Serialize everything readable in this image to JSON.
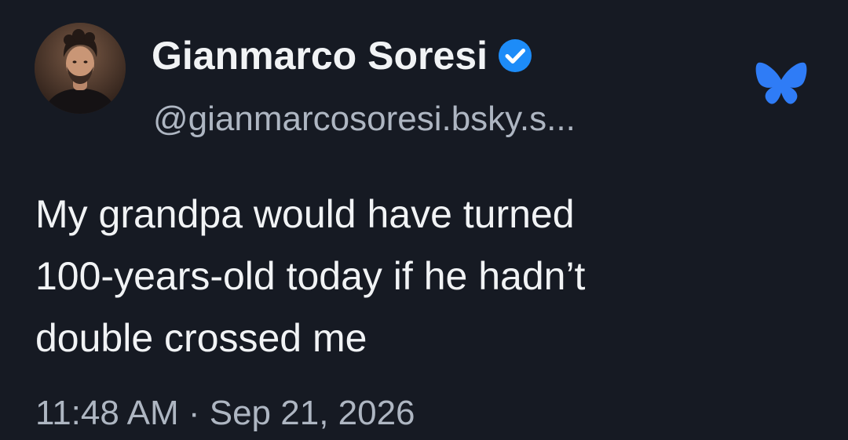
{
  "post": {
    "author": {
      "display_name": "Gianmarco Soresi",
      "handle": "@gianmarcosoresi.bsky.s...",
      "verified": true,
      "avatar_icon": "person-portrait"
    },
    "platform_icon": "butterfly-icon",
    "text": "My grandpa would have turned\n100-years-old today if he hadn’t\ndouble crossed me",
    "timestamp": "11:48 AM · Sep 21, 2026"
  },
  "colors": {
    "background": "#161a23",
    "primary_text": "#f1f3f5",
    "secondary_text": "#aeb6c2",
    "verified_badge": "#1d8cf8",
    "brand": "#2f7cf6"
  }
}
